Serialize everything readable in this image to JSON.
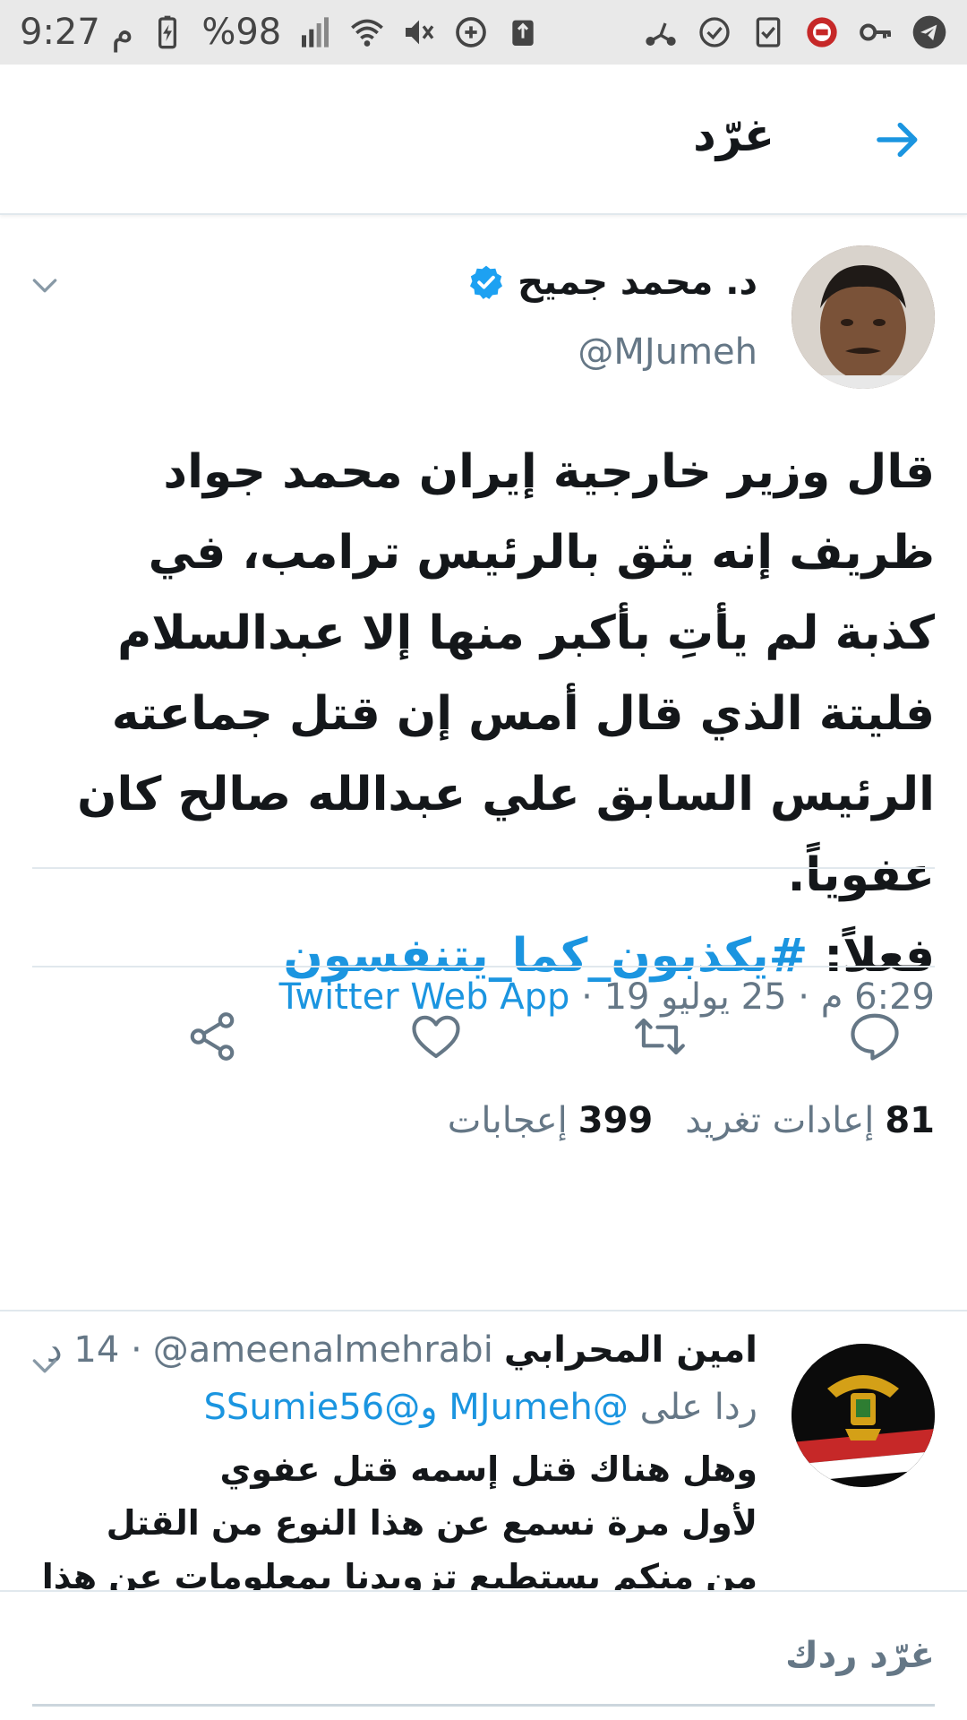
{
  "status_bar": {
    "time": "9:27 م",
    "battery": "%98",
    "icons": [
      "telegram-icon",
      "key-icon",
      "app-badge-icon",
      "checklist-icon",
      "check-circle-icon",
      "scooter-icon",
      "recycle-icon",
      "data-saver-icon",
      "mute-icon",
      "wifi-icon",
      "signal-icon",
      "battery-icon"
    ]
  },
  "header": {
    "title": "غرّد",
    "back_icon": "arrow-right-icon"
  },
  "tweet": {
    "author_name": "د. محمد جميح",
    "handle": "@MJumeh",
    "verified": true,
    "text_lines": [
      "قال وزير خارجية إيران محمد جواد",
      "ظريف إنه يثق بالرئيس ترامب، في",
      "كذبة لم يأتِ بأكبر منها إلا عبدالسلام",
      "فليتة الذي قال أمس إن قتل جماعته",
      "الرئيس السابق علي عبدالله صالح كان",
      "عفوياً."
    ],
    "last_line_prefix": "فعلاً: ",
    "hashtag": "#يكذبون_كما_يتنفسون",
    "time": "6:29 م",
    "date": "25 يوليو 19",
    "separator": " · ",
    "source": "Twitter Web App",
    "retweets_count": "81",
    "retweets_label": "إعادات تغريد",
    "likes_count": "399",
    "likes_label": "إعجابات"
  },
  "actions": [
    {
      "name": "reply-icon"
    },
    {
      "name": "retweet-icon"
    },
    {
      "name": "like-icon"
    },
    {
      "name": "share-icon"
    }
  ],
  "reply": {
    "name": "امين المحرابي",
    "handle": "@ameenalmehrabi",
    "time": "· 14 د",
    "reply_to_label": "ردا على",
    "mention_1": "@MJumeh",
    "conjunction": " و",
    "mention_2": "@SSumie56",
    "text_lines": [
      "وهل هناك قتل إسمه قتل عفوي",
      "لأول مرة نسمع عن هذا النوع من القتل",
      "من منكم يستطيع تزويدنا بمعلومات عن هذا"
    ]
  },
  "composer": {
    "placeholder": "غرّد ردك"
  },
  "colors": {
    "accent": "#1b95e0",
    "muted": "#657786",
    "text": "#14171a",
    "divider": "#e1e8ed"
  }
}
